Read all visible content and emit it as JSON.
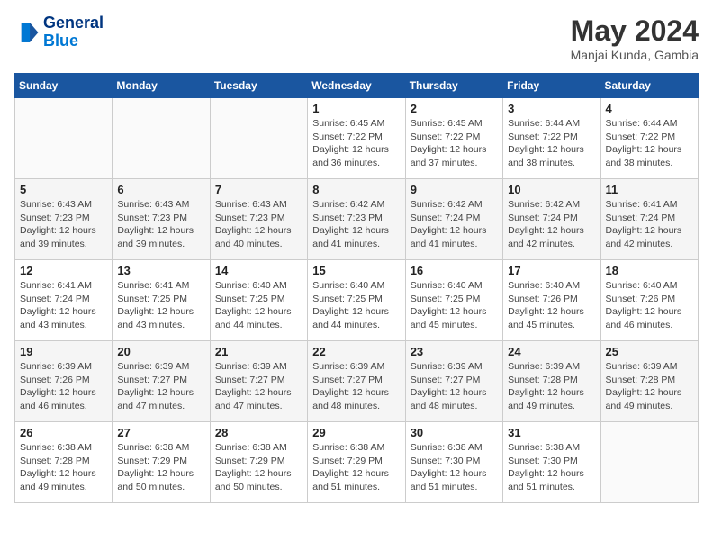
{
  "logo": {
    "line1": "General",
    "line2": "Blue"
  },
  "title": "May 2024",
  "location": "Manjai Kunda, Gambia",
  "weekdays": [
    "Sunday",
    "Monday",
    "Tuesday",
    "Wednesday",
    "Thursday",
    "Friday",
    "Saturday"
  ],
  "weeks": [
    [
      null,
      null,
      null,
      {
        "day": 1,
        "sunrise": "6:45 AM",
        "sunset": "7:22 PM",
        "daylight": "12 hours and 36 minutes."
      },
      {
        "day": 2,
        "sunrise": "6:45 AM",
        "sunset": "7:22 PM",
        "daylight": "12 hours and 37 minutes."
      },
      {
        "day": 3,
        "sunrise": "6:44 AM",
        "sunset": "7:22 PM",
        "daylight": "12 hours and 38 minutes."
      },
      {
        "day": 4,
        "sunrise": "6:44 AM",
        "sunset": "7:22 PM",
        "daylight": "12 hours and 38 minutes."
      }
    ],
    [
      {
        "day": 5,
        "sunrise": "6:43 AM",
        "sunset": "7:23 PM",
        "daylight": "12 hours and 39 minutes."
      },
      {
        "day": 6,
        "sunrise": "6:43 AM",
        "sunset": "7:23 PM",
        "daylight": "12 hours and 39 minutes."
      },
      {
        "day": 7,
        "sunrise": "6:43 AM",
        "sunset": "7:23 PM",
        "daylight": "12 hours and 40 minutes."
      },
      {
        "day": 8,
        "sunrise": "6:42 AM",
        "sunset": "7:23 PM",
        "daylight": "12 hours and 41 minutes."
      },
      {
        "day": 9,
        "sunrise": "6:42 AM",
        "sunset": "7:24 PM",
        "daylight": "12 hours and 41 minutes."
      },
      {
        "day": 10,
        "sunrise": "6:42 AM",
        "sunset": "7:24 PM",
        "daylight": "12 hours and 42 minutes."
      },
      {
        "day": 11,
        "sunrise": "6:41 AM",
        "sunset": "7:24 PM",
        "daylight": "12 hours and 42 minutes."
      }
    ],
    [
      {
        "day": 12,
        "sunrise": "6:41 AM",
        "sunset": "7:24 PM",
        "daylight": "12 hours and 43 minutes."
      },
      {
        "day": 13,
        "sunrise": "6:41 AM",
        "sunset": "7:25 PM",
        "daylight": "12 hours and 43 minutes."
      },
      {
        "day": 14,
        "sunrise": "6:40 AM",
        "sunset": "7:25 PM",
        "daylight": "12 hours and 44 minutes."
      },
      {
        "day": 15,
        "sunrise": "6:40 AM",
        "sunset": "7:25 PM",
        "daylight": "12 hours and 44 minutes."
      },
      {
        "day": 16,
        "sunrise": "6:40 AM",
        "sunset": "7:25 PM",
        "daylight": "12 hours and 45 minutes."
      },
      {
        "day": 17,
        "sunrise": "6:40 AM",
        "sunset": "7:26 PM",
        "daylight": "12 hours and 45 minutes."
      },
      {
        "day": 18,
        "sunrise": "6:40 AM",
        "sunset": "7:26 PM",
        "daylight": "12 hours and 46 minutes."
      }
    ],
    [
      {
        "day": 19,
        "sunrise": "6:39 AM",
        "sunset": "7:26 PM",
        "daylight": "12 hours and 46 minutes."
      },
      {
        "day": 20,
        "sunrise": "6:39 AM",
        "sunset": "7:27 PM",
        "daylight": "12 hours and 47 minutes."
      },
      {
        "day": 21,
        "sunrise": "6:39 AM",
        "sunset": "7:27 PM",
        "daylight": "12 hours and 47 minutes."
      },
      {
        "day": 22,
        "sunrise": "6:39 AM",
        "sunset": "7:27 PM",
        "daylight": "12 hours and 48 minutes."
      },
      {
        "day": 23,
        "sunrise": "6:39 AM",
        "sunset": "7:27 PM",
        "daylight": "12 hours and 48 minutes."
      },
      {
        "day": 24,
        "sunrise": "6:39 AM",
        "sunset": "7:28 PM",
        "daylight": "12 hours and 49 minutes."
      },
      {
        "day": 25,
        "sunrise": "6:39 AM",
        "sunset": "7:28 PM",
        "daylight": "12 hours and 49 minutes."
      }
    ],
    [
      {
        "day": 26,
        "sunrise": "6:38 AM",
        "sunset": "7:28 PM",
        "daylight": "12 hours and 49 minutes."
      },
      {
        "day": 27,
        "sunrise": "6:38 AM",
        "sunset": "7:29 PM",
        "daylight": "12 hours and 50 minutes."
      },
      {
        "day": 28,
        "sunrise": "6:38 AM",
        "sunset": "7:29 PM",
        "daylight": "12 hours and 50 minutes."
      },
      {
        "day": 29,
        "sunrise": "6:38 AM",
        "sunset": "7:29 PM",
        "daylight": "12 hours and 51 minutes."
      },
      {
        "day": 30,
        "sunrise": "6:38 AM",
        "sunset": "7:30 PM",
        "daylight": "12 hours and 51 minutes."
      },
      {
        "day": 31,
        "sunrise": "6:38 AM",
        "sunset": "7:30 PM",
        "daylight": "12 hours and 51 minutes."
      },
      null
    ]
  ],
  "labels": {
    "sunrise": "Sunrise:",
    "sunset": "Sunset:",
    "daylight": "Daylight:"
  }
}
